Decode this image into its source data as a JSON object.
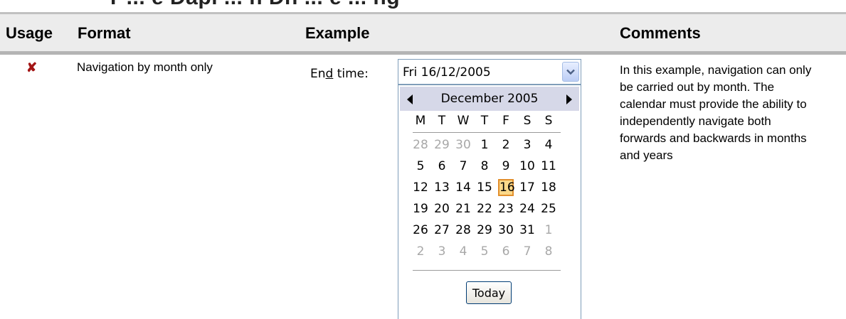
{
  "page": {
    "cut_heading": "T   ... e  Dapi   ... n  Dn  ...  e  ... ng"
  },
  "table": {
    "headers": {
      "usage": "Usage",
      "format": "Format",
      "example": "Example",
      "comments": "Comments"
    },
    "row": {
      "usage_icon": "cross-icon",
      "usage_color": "#a31515",
      "format": "Navigation by month only",
      "comment_lines": [
        "In this example, navigation can only",
        "be carried out by month. The",
        "calendar must provide the ability to",
        "independently navigate both",
        "forwards and backwards in months",
        "and years"
      ]
    }
  },
  "widget": {
    "label_pre": "En",
    "label_accel": "d",
    "label_post": " time:",
    "value": "Fri 16/12/2005",
    "calendar": {
      "month_title": "December 2005",
      "weekdays": [
        "M",
        "T",
        "W",
        "T",
        "F",
        "S",
        "S"
      ],
      "weeks": [
        [
          {
            "d": "28",
            "o": true
          },
          {
            "d": "29",
            "o": true
          },
          {
            "d": "30",
            "o": true
          },
          {
            "d": "1"
          },
          {
            "d": "2"
          },
          {
            "d": "3"
          },
          {
            "d": "4"
          }
        ],
        [
          {
            "d": "5"
          },
          {
            "d": "6"
          },
          {
            "d": "7"
          },
          {
            "d": "8"
          },
          {
            "d": "9"
          },
          {
            "d": "10"
          },
          {
            "d": "11"
          }
        ],
        [
          {
            "d": "12"
          },
          {
            "d": "13"
          },
          {
            "d": "14"
          },
          {
            "d": "15"
          },
          {
            "d": "16",
            "sel": true
          },
          {
            "d": "17"
          },
          {
            "d": "18"
          }
        ],
        [
          {
            "d": "19"
          },
          {
            "d": "20"
          },
          {
            "d": "21"
          },
          {
            "d": "22"
          },
          {
            "d": "23"
          },
          {
            "d": "24"
          },
          {
            "d": "25"
          }
        ],
        [
          {
            "d": "26"
          },
          {
            "d": "27"
          },
          {
            "d": "28"
          },
          {
            "d": "29"
          },
          {
            "d": "30"
          },
          {
            "d": "31"
          },
          {
            "d": "1",
            "o": true
          }
        ],
        [
          {
            "d": "2",
            "o": true
          },
          {
            "d": "3",
            "o": true
          },
          {
            "d": "4",
            "o": true
          },
          {
            "d": "5",
            "o": true
          },
          {
            "d": "6",
            "o": true
          },
          {
            "d": "7",
            "o": true
          },
          {
            "d": "8",
            "o": true
          }
        ]
      ],
      "today_label": "Today",
      "selected_color": "#fbd98a",
      "header_color": "#d6d8e8"
    }
  }
}
